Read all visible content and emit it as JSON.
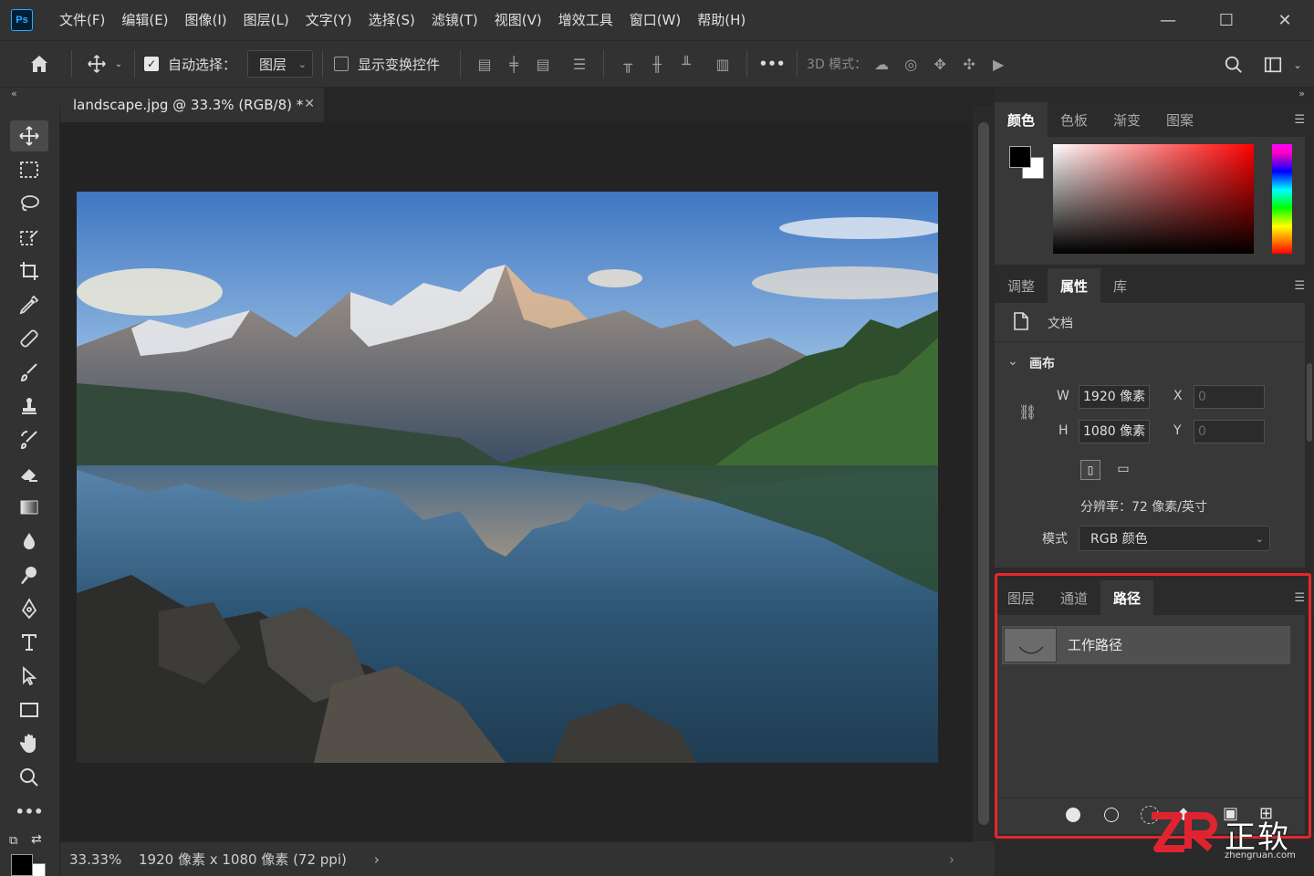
{
  "app": {
    "logo": "Ps"
  },
  "menu": [
    "文件(F)",
    "编辑(E)",
    "图像(I)",
    "图层(L)",
    "文字(Y)",
    "选择(S)",
    "滤镜(T)",
    "视图(V)",
    "增效工具",
    "窗口(W)",
    "帮助(H)"
  ],
  "window_controls": {
    "minimize": "—",
    "maximize": "☐",
    "close": "✕"
  },
  "options": {
    "auto_select_label": "自动选择：",
    "auto_select_checked": true,
    "auto_select_target": "图层",
    "show_transform_label": "显示变换控件",
    "show_transform_checked": false,
    "more": "•••",
    "mode_3d_label": "3D 模式："
  },
  "document": {
    "tab_title": "landscape.jpg @ 33.3% (RGB/8) *",
    "zoom": "33.33%",
    "dimensions": "1920 像素 x 1080 像素 (72 ppi)"
  },
  "color_panel": {
    "tabs": [
      "颜色",
      "色板",
      "渐变",
      "图案"
    ],
    "active_tab": "颜色",
    "foreground": "#000000",
    "background": "#ffffff"
  },
  "properties_panel": {
    "tabs": [
      "调整",
      "属性",
      "库"
    ],
    "active_tab": "属性",
    "doc_label": "文档",
    "section": "画布",
    "w_label": "W",
    "w_value": "1920 像素",
    "h_label": "H",
    "h_value": "1080 像素",
    "x_label": "X",
    "x_value": "0",
    "y_label": "Y",
    "y_value": "0",
    "resolution": "分辨率：72 像素/英寸",
    "mode_label": "模式",
    "mode_value": "RGB 颜色"
  },
  "paths_panel": {
    "tabs": [
      "图层",
      "通道",
      "路径"
    ],
    "active_tab": "路径",
    "items": [
      {
        "name": "工作路径"
      }
    ]
  },
  "watermark": {
    "brand": "正软",
    "site": "zhengruan.com"
  }
}
